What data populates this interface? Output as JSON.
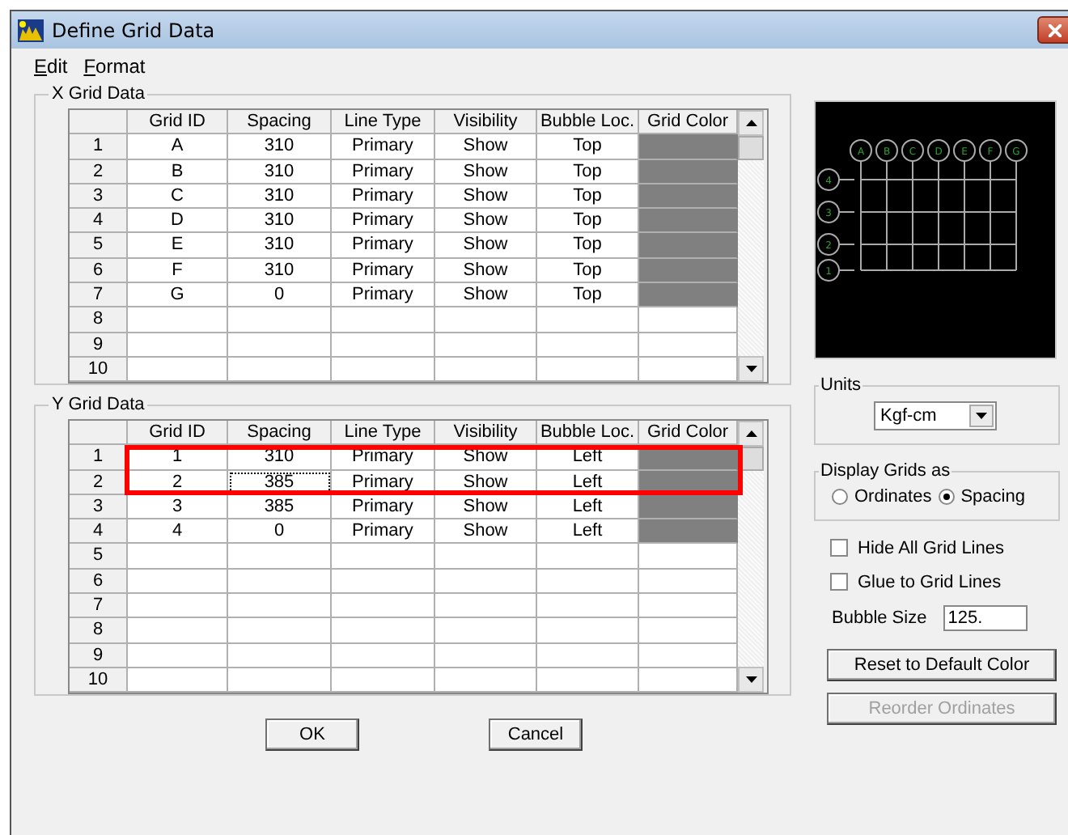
{
  "window": {
    "title": "Define Grid Data"
  },
  "menu": [
    "Edit",
    "Format"
  ],
  "x_grid": {
    "title": "X Grid Data",
    "columns": [
      "Grid ID",
      "Spacing",
      "Line Type",
      "Visibility",
      "Bubble Loc.",
      "Grid Color"
    ],
    "rows": [
      {
        "number": "1",
        "cells": [
          "A",
          "310",
          "Primary",
          "Show",
          "Top"
        ],
        "color": "#808080",
        "focused": false
      },
      {
        "number": "2",
        "cells": [
          "B",
          "310",
          "Primary",
          "Show",
          "Top"
        ],
        "color": "#808080",
        "focused": false
      },
      {
        "number": "3",
        "cells": [
          "C",
          "310",
          "Primary",
          "Show",
          "Top"
        ],
        "color": "#808080",
        "focused": false
      },
      {
        "number": "4",
        "cells": [
          "D",
          "310",
          "Primary",
          "Show",
          "Top"
        ],
        "color": "#808080",
        "focused": false
      },
      {
        "number": "5",
        "cells": [
          "E",
          "310",
          "Primary",
          "Show",
          "Top"
        ],
        "color": "#808080",
        "focused": false
      },
      {
        "number": "6",
        "cells": [
          "F",
          "310",
          "Primary",
          "Show",
          "Top"
        ],
        "color": "#808080",
        "focused": false
      },
      {
        "number": "7",
        "cells": [
          "G",
          "0",
          "Primary",
          "Show",
          "Top"
        ],
        "color": "#808080",
        "focused": false
      },
      {
        "number": "8",
        "cells": [],
        "focused": false
      },
      {
        "number": "9",
        "cells": [],
        "focused": false
      },
      {
        "number": "10",
        "cells": [],
        "focused": false
      }
    ]
  },
  "y_grid": {
    "title": "Y Grid Data",
    "columns": [
      "Grid ID",
      "Spacing",
      "Line Type",
      "Visibility",
      "Bubble Loc.",
      "Grid Color"
    ],
    "rows": [
      {
        "number": "1",
        "cells": [
          "1",
          "310",
          "Primary",
          "Show",
          "Left"
        ],
        "color": "#808080",
        "focused": false
      },
      {
        "number": "2",
        "cells": [
          "2",
          "385",
          "Primary",
          "Show",
          "Left"
        ],
        "color": "#808080",
        "focused": true
      },
      {
        "number": "3",
        "cells": [
          "3",
          "385",
          "Primary",
          "Show",
          "Left"
        ],
        "color": "#808080",
        "focused": false
      },
      {
        "number": "4",
        "cells": [
          "4",
          "0",
          "Primary",
          "Show",
          "Left"
        ],
        "color": "#808080",
        "focused": false
      },
      {
        "number": "5",
        "cells": [],
        "focused": false
      },
      {
        "number": "6",
        "cells": [],
        "focused": false
      },
      {
        "number": "7",
        "cells": [],
        "focused": false
      },
      {
        "number": "8",
        "cells": [],
        "focused": false
      },
      {
        "number": "9",
        "cells": [],
        "focused": false
      },
      {
        "number": "10",
        "cells": [],
        "focused": false
      }
    ],
    "annotation": {
      "kind": "highlight-frame"
    }
  },
  "preview": {
    "x_bubbles": [
      "A",
      "B",
      "C",
      "D",
      "E",
      "F",
      "G"
    ],
    "y_bubbles": [
      "4",
      "3",
      "2",
      "1"
    ]
  },
  "units": {
    "title": "Units",
    "value": "Kgf-cm"
  },
  "display": {
    "title": "Display Grids as",
    "options": [
      {
        "label": "Ordinates",
        "selected": false
      },
      {
        "label": "Spacing",
        "selected": true
      }
    ]
  },
  "checkboxes": [
    {
      "label": "Hide All Grid Lines",
      "checked": false
    },
    {
      "label": "Glue to Grid Lines",
      "checked": false
    }
  ],
  "bubble_size": {
    "label": "Bubble Size",
    "value": "125."
  },
  "side_buttons": [
    {
      "label": "Reset to Default Color",
      "disabled": false
    },
    {
      "label": "Reorder Ordinates",
      "disabled": true
    }
  ],
  "buttons": [
    "OK",
    "Cancel"
  ]
}
